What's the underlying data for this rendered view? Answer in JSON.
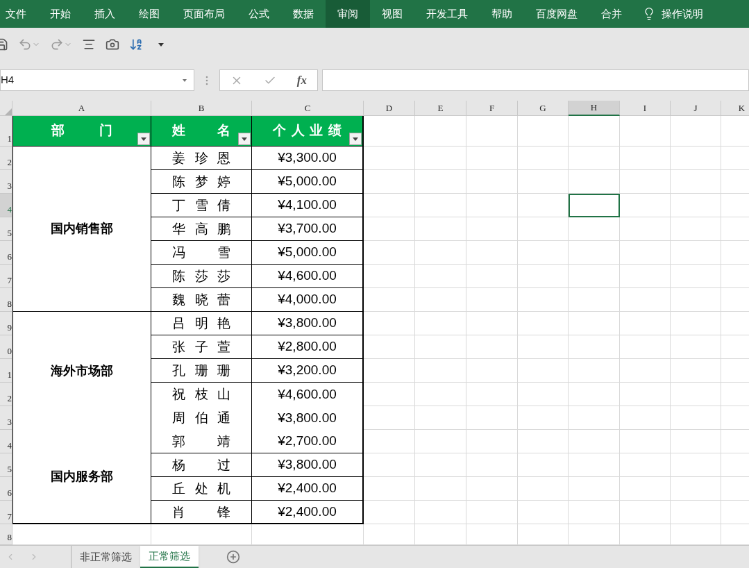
{
  "ribbon_tabs": [
    {
      "label": "文件",
      "selected": false
    },
    {
      "label": "开始",
      "selected": false
    },
    {
      "label": "插入",
      "selected": false
    },
    {
      "label": "绘图",
      "selected": false
    },
    {
      "label": "页面布局",
      "selected": false
    },
    {
      "label": "公式",
      "selected": false
    },
    {
      "label": "数据",
      "selected": false
    },
    {
      "label": "审阅",
      "selected": true
    },
    {
      "label": "视图",
      "selected": false
    },
    {
      "label": "开发工具",
      "selected": false
    },
    {
      "label": "帮助",
      "selected": false
    },
    {
      "label": "百度网盘",
      "selected": false
    },
    {
      "label": "合并",
      "selected": false
    }
  ],
  "tell_me": "操作说明",
  "name_box": {
    "value": "H4"
  },
  "function_button": "fx",
  "columns": [
    {
      "label": "A",
      "selected": false
    },
    {
      "label": "B",
      "selected": false
    },
    {
      "label": "C",
      "selected": false
    },
    {
      "label": "D",
      "selected": false
    },
    {
      "label": "E",
      "selected": false
    },
    {
      "label": "F",
      "selected": false
    },
    {
      "label": "G",
      "selected": false
    },
    {
      "label": "H",
      "selected": true
    },
    {
      "label": "I",
      "selected": false
    },
    {
      "label": "J",
      "selected": false
    },
    {
      "label": "K",
      "selected": false
    }
  ],
  "rows": [
    {
      "label": "1",
      "selected": false
    },
    {
      "label": "2",
      "selected": false
    },
    {
      "label": "3",
      "selected": false
    },
    {
      "label": "4",
      "selected": true
    },
    {
      "label": "5",
      "selected": false
    },
    {
      "label": "6",
      "selected": false
    },
    {
      "label": "7",
      "selected": false
    },
    {
      "label": "8",
      "selected": false
    },
    {
      "label": "9",
      "selected": false
    },
    {
      "label": "0",
      "selected": false
    },
    {
      "label": "1",
      "selected": false
    },
    {
      "label": "2",
      "selected": false
    },
    {
      "label": "3",
      "selected": false
    },
    {
      "label": "4",
      "selected": false
    },
    {
      "label": "5",
      "selected": false
    },
    {
      "label": "6",
      "selected": false
    },
    {
      "label": "7",
      "selected": false
    },
    {
      "label": "8",
      "selected": false
    }
  ],
  "table": {
    "headers": [
      "部门",
      "姓名",
      "个人业绩"
    ],
    "groups": [
      {
        "department": "国内销售部",
        "ruled": true,
        "rows": [
          {
            "name": "姜珍恩",
            "amount": "¥3,300.00",
            "ruled": true
          },
          {
            "name": "陈梦婷",
            "amount": "¥5,000.00",
            "ruled": true
          },
          {
            "name": "丁雪倩",
            "amount": "¥4,100.00",
            "ruled": true
          },
          {
            "name": "华高鹏",
            "amount": "¥3,700.00",
            "ruled": true
          },
          {
            "name": "冯雪",
            "amount": "¥5,000.00",
            "ruled": true
          },
          {
            "name": "陈莎莎",
            "amount": "¥4,600.00",
            "ruled": true
          },
          {
            "name": "魏晓蕾",
            "amount": "¥4,000.00",
            "ruled": true
          }
        ]
      },
      {
        "department": "海外市场部",
        "ruled": false,
        "rows": [
          {
            "name": "吕明艳",
            "amount": "¥3,800.00",
            "ruled": true
          },
          {
            "name": "张子萱",
            "amount": "¥2,800.00",
            "ruled": true
          },
          {
            "name": "孔珊珊",
            "amount": "¥3,200.00",
            "ruled": true
          },
          {
            "name": "祝枝山",
            "amount": "¥4,600.00",
            "ruled": false
          },
          {
            "name": "周伯通",
            "amount": "¥3,800.00",
            "ruled": false
          }
        ]
      },
      {
        "department": "国内服务部",
        "ruled": true,
        "rows": [
          {
            "name": "郭靖",
            "amount": "¥2,700.00",
            "ruled": true
          },
          {
            "name": "杨过",
            "amount": "¥3,800.00",
            "ruled": true
          },
          {
            "name": "丘处机",
            "amount": "¥2,400.00",
            "ruled": true
          },
          {
            "name": "肖锋",
            "amount": "¥2,400.00",
            "ruled": true
          }
        ]
      }
    ]
  },
  "sheet_tabs": [
    {
      "label": "非正常筛选",
      "selected": false
    },
    {
      "label": "正常筛选",
      "selected": true
    }
  ]
}
